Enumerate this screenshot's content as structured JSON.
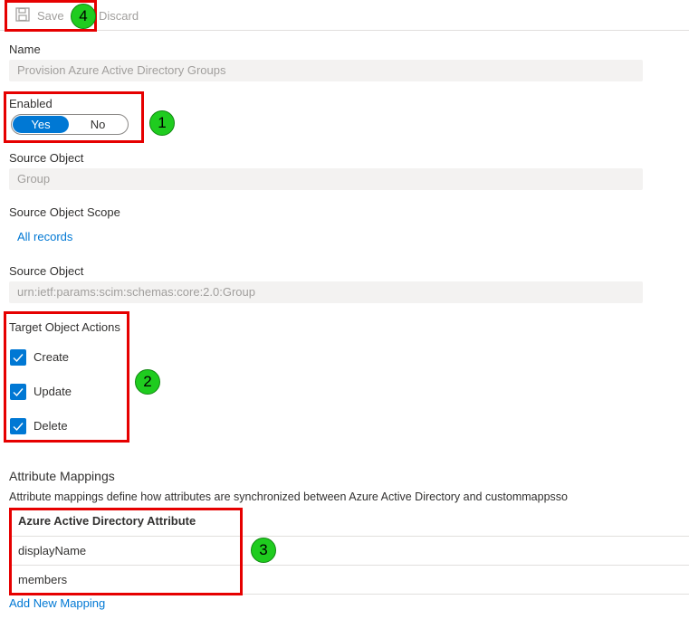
{
  "toolbar": {
    "save_label": "Save",
    "discard_label": "Discard",
    "save_icon": "floppy-disk-icon"
  },
  "form": {
    "name_label": "Name",
    "name_value": "Provision Azure Active Directory Groups",
    "enabled_label": "Enabled",
    "toggle_yes": "Yes",
    "toggle_no": "No",
    "enabled_selected": "Yes",
    "source_object_label": "Source Object",
    "source_object_value": "Group",
    "source_scope_label": "Source Object Scope",
    "source_scope_link": "All records",
    "target_object_label": "Source Object",
    "target_object_value": "urn:ietf:params:scim:schemas:core:2.0:Group",
    "actions_label": "Target Object Actions",
    "actions": [
      {
        "label": "Create",
        "checked": true
      },
      {
        "label": "Update",
        "checked": true
      },
      {
        "label": "Delete",
        "checked": true
      }
    ]
  },
  "mappings": {
    "title": "Attribute Mappings",
    "description": "Attribute mappings define how attributes are synchronized between Azure Active Directory and custommappsso",
    "column_header": "Azure Active Directory Attribute",
    "rows": [
      "displayName",
      "members"
    ],
    "add_link": "Add New Mapping"
  },
  "annotations": {
    "badge_1": "1",
    "badge_2": "2",
    "badge_3": "3",
    "badge_4": "4",
    "box_color": "#e60000",
    "badge_color": "#1fcc1f"
  },
  "colors": {
    "accent": "#0078d4",
    "field_bg": "#f3f2f1",
    "disabled_text": "#a19f9d"
  }
}
